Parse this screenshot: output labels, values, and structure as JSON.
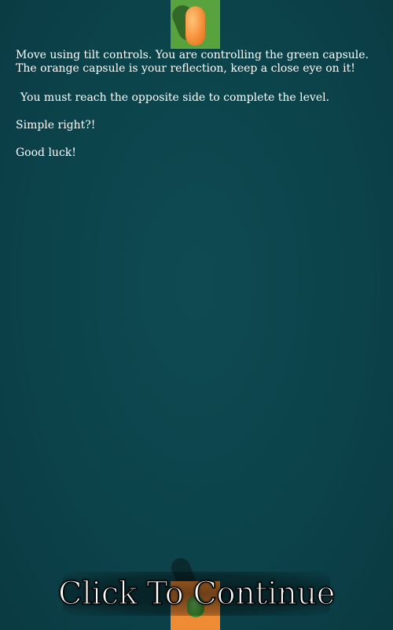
{
  "instructions": {
    "line_move": "Move using tilt controls. You are controlling the green capsule. The orange capsule is your reflection, keep a close eye on it!",
    "line_reach": "You must reach the opposite side to complete the level.",
    "line_simple": "Simple right?!",
    "line_luck": "Good luck!"
  },
  "continue_label": "Click To Continue",
  "colors": {
    "background": "#0c434b",
    "top_goal": "#58a33d",
    "bottom_goal": "#ef8b34",
    "player_capsule": "#3e9a34",
    "reflection_capsule": "#f5903a"
  }
}
